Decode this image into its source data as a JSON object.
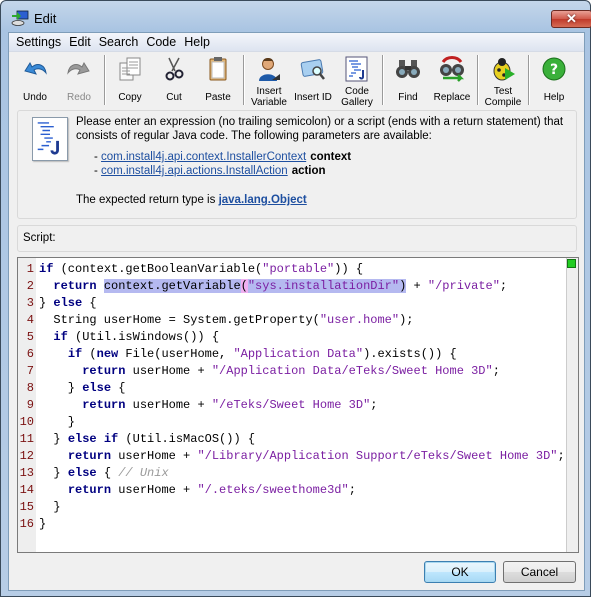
{
  "window": {
    "title": "Edit",
    "close_glyph": "✕"
  },
  "menu": [
    "Settings",
    "Edit",
    "Search",
    "Code",
    "Help"
  ],
  "toolbar": [
    {
      "label": "Undo",
      "icon": "undo-icon",
      "enabled": true
    },
    {
      "label": "Redo",
      "icon": "redo-icon",
      "enabled": false
    },
    {
      "separator": true
    },
    {
      "label": "Copy",
      "icon": "copy-icon",
      "enabled": true
    },
    {
      "label": "Cut",
      "icon": "cut-icon",
      "enabled": true
    },
    {
      "label": "Paste",
      "icon": "paste-icon",
      "enabled": true
    },
    {
      "separator": true
    },
    {
      "label": "Insert Variable",
      "icon": "insert-variable-icon",
      "enabled": true
    },
    {
      "label": "Insert ID",
      "icon": "insert-id-icon",
      "enabled": true
    },
    {
      "label": "Code Gallery",
      "icon": "code-gallery-icon",
      "enabled": true
    },
    {
      "separator": true
    },
    {
      "label": "Find",
      "icon": "find-icon",
      "enabled": true
    },
    {
      "label": "Replace",
      "icon": "replace-icon",
      "enabled": true
    },
    {
      "separator": true
    },
    {
      "label": "Test Compile",
      "icon": "test-compile-icon",
      "enabled": true
    },
    {
      "separator": true
    },
    {
      "label": "Help",
      "icon": "help-icon",
      "enabled": true
    }
  ],
  "info": {
    "line1": "Please enter an expression (no trailing semicolon) or a script (ends with a return statement) that",
    "line2": "consists of regular Java code. The following parameters are available:",
    "params": [
      {
        "type": "com.install4j.api.context.InstallerContext",
        "name": "context"
      },
      {
        "type": "com.install4j.api.actions.InstallAction",
        "name": "action"
      }
    ],
    "return_prefix": "The expected return type is ",
    "return_type": "java.lang.Object"
  },
  "script_label": "Script:",
  "code_lines": [
    "if (context.getBooleanVariable(\"portable\")) {",
    "  return context.getVariable(\"sys.installationDir\") + \"/private\";",
    "} else {",
    "  String userHome = System.getProperty(\"user.home\");",
    "  if (Util.isWindows()) {",
    "    if (new File(userHome, \"Application Data\").exists()) {",
    "      return userHome + \"/Application Data/eTeks/Sweet Home 3D\";",
    "    } else {",
    "      return userHome + \"/eTeks/Sweet Home 3D\";",
    "    }",
    "  } else if (Util.isMacOS()) {",
    "    return userHome + \"/Library/Application Support/eTeks/Sweet Home 3D\";",
    "  } else { // Unix",
    "    return userHome + \"/.eteks/sweethome3d\";",
    "  }",
    "}"
  ],
  "selection": {
    "line": 2,
    "text": "context.getVariable(\"sys.installationDir\")"
  },
  "status_color": "#22cc22",
  "buttons": {
    "ok": "OK",
    "cancel": "Cancel"
  }
}
